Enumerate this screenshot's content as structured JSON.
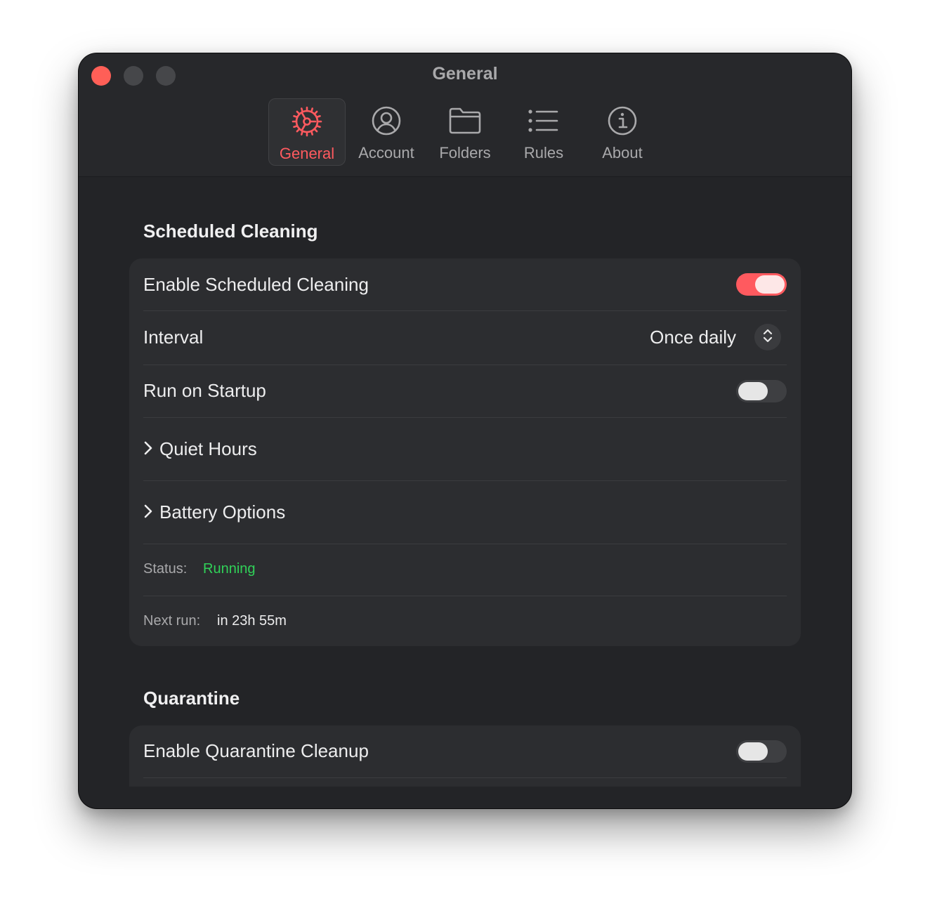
{
  "window": {
    "title": "General"
  },
  "toolbar": {
    "tabs": [
      {
        "label": "General",
        "icon": "gear-icon",
        "active": true
      },
      {
        "label": "Account",
        "icon": "person-circle-icon",
        "active": false
      },
      {
        "label": "Folders",
        "icon": "folder-icon",
        "active": false
      },
      {
        "label": "Rules",
        "icon": "list-icon",
        "active": false
      },
      {
        "label": "About",
        "icon": "info-circle-icon",
        "active": false
      }
    ]
  },
  "scheduled": {
    "title": "Scheduled Cleaning",
    "enable_label": "Enable Scheduled Cleaning",
    "enable_on": true,
    "interval_label": "Interval",
    "interval_value": "Once daily",
    "startup_label": "Run on Startup",
    "startup_on": false,
    "quiet_hours_label": "Quiet Hours",
    "battery_label": "Battery Options",
    "status_label": "Status:",
    "status_value": "Running",
    "next_run_label": "Next run:",
    "next_run_value": "in 23h 55m"
  },
  "quarantine": {
    "title": "Quarantine",
    "enable_label": "Enable Quarantine Cleanup",
    "enable_on": false
  },
  "colors": {
    "accent": "#ff5a5f",
    "status_running": "#30d158",
    "window_bg": "#232427",
    "card_bg": "#2c2d30"
  }
}
